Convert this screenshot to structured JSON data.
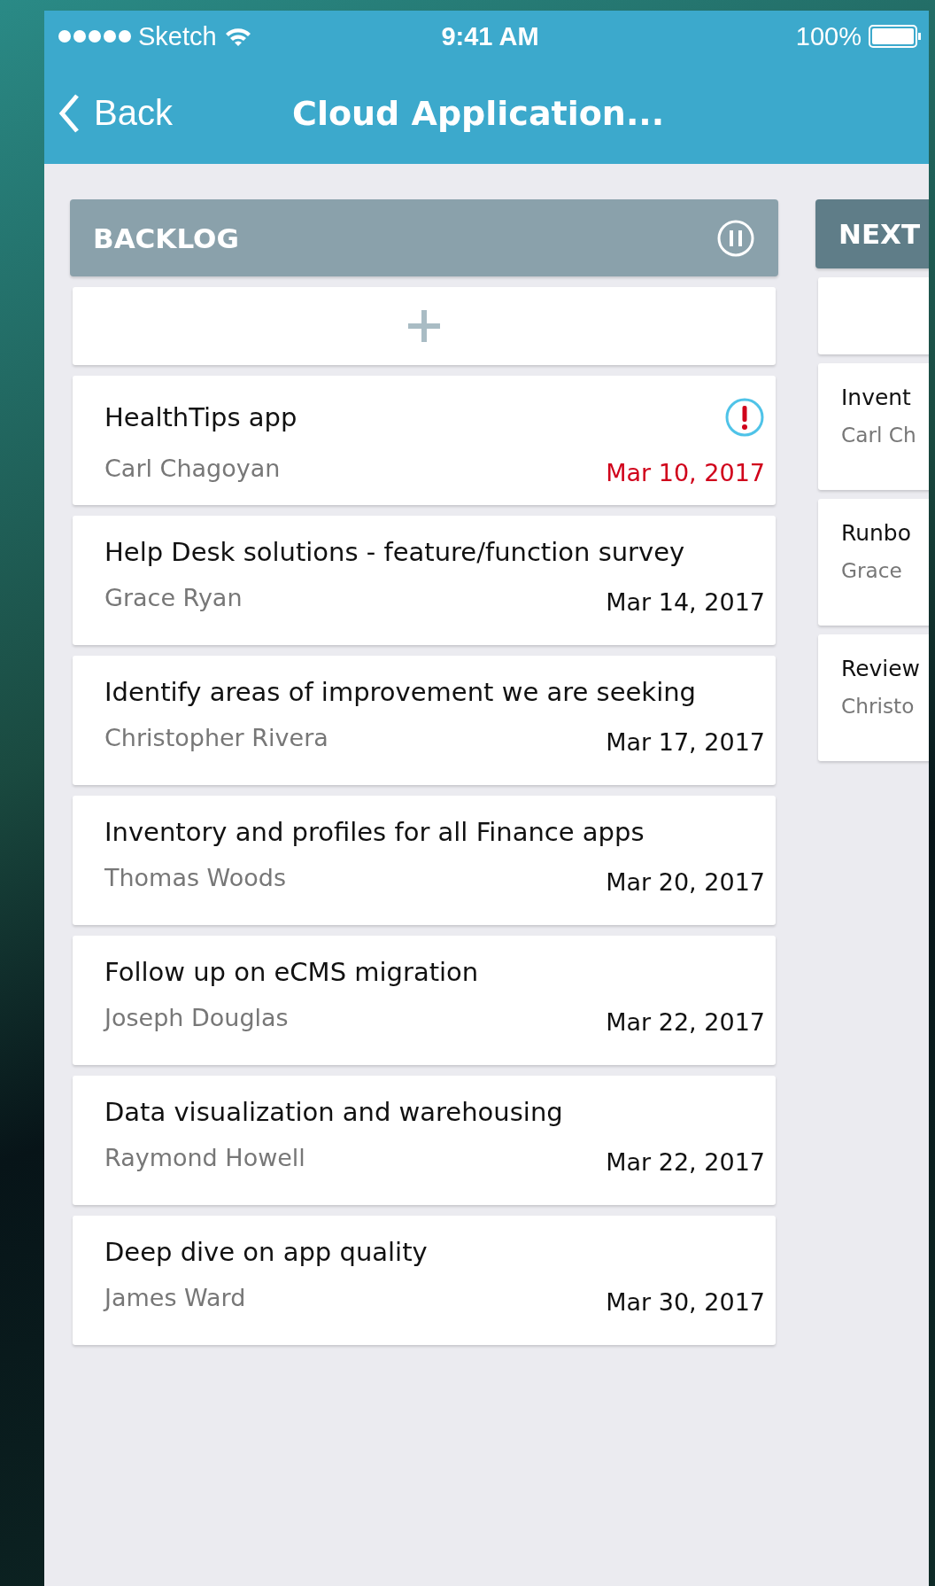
{
  "status_bar": {
    "carrier": "Sketch",
    "time": "9:41 AM",
    "battery": "100%"
  },
  "nav": {
    "back": "Back",
    "title": "Cloud Application..."
  },
  "columns": [
    {
      "title": "BACKLOG",
      "paused": true,
      "cards": [
        {
          "title": "HealthTips app",
          "owner": "Carl Chagoyan",
          "date": "Mar 10, 2017",
          "flagged": true,
          "overdue": true
        },
        {
          "title": "Help Desk solutions - feature/function survey",
          "owner": "Grace Ryan",
          "date": "Mar 14, 2017",
          "flagged": false,
          "overdue": false
        },
        {
          "title": "Identify areas of improvement we are seeking",
          "owner": "Christopher Rivera",
          "date": "Mar 17, 2017",
          "flagged": false,
          "overdue": false
        },
        {
          "title": "Inventory and profiles for all Finance apps",
          "owner": "Thomas Woods",
          "date": "Mar 20, 2017",
          "flagged": false,
          "overdue": false
        },
        {
          "title": "Follow up on eCMS migration",
          "owner": "Joseph Douglas",
          "date": "Mar 22, 2017",
          "flagged": false,
          "overdue": false
        },
        {
          "title": "Data visualization and warehousing",
          "owner": "Raymond Howell",
          "date": "Mar 22, 2017",
          "flagged": false,
          "overdue": false
        },
        {
          "title": "Deep dive on app quality",
          "owner": "James Ward",
          "date": "Mar 30, 2017",
          "flagged": false,
          "overdue": false
        }
      ]
    },
    {
      "title": "NEXT",
      "cards": [
        {
          "title": "Invent",
          "owner": "Carl Ch"
        },
        {
          "title": "Runbo",
          "owner": "Grace"
        },
        {
          "title": "Review",
          "owner": "Christo"
        }
      ]
    }
  ]
}
